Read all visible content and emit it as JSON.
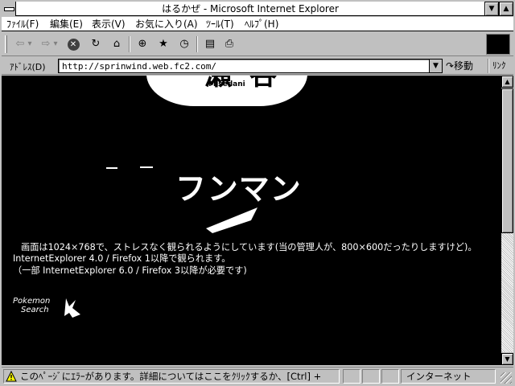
{
  "window": {
    "title": "はるかぜ - Microsoft Internet Explorer",
    "minimize_glyph": "▼",
    "maximize_glyph": "▲"
  },
  "menu": {
    "items": [
      {
        "label": "ﾌｧｲﾙ(F)"
      },
      {
        "label": "編集(E)"
      },
      {
        "label": "表示(V)"
      },
      {
        "label": "お気に入り(A)"
      },
      {
        "label": "ﾂｰﾙ(T)"
      },
      {
        "label": "ﾍﾙﾌﾟ(H)"
      }
    ]
  },
  "toolbar": {
    "back_glyph": "⇦",
    "forward_glyph": "⇨",
    "dropdown_glyph": "▾",
    "stop_glyph": "✕",
    "refresh_glyph": "↻",
    "home_glyph": "⌂",
    "search_glyph": "⊕",
    "favorites_glyph": "★",
    "history_glyph": "◷",
    "mail_glyph": "▤",
    "print_glyph": "⎙"
  },
  "address": {
    "label": "ｱﾄﾞﾚｽ(D)",
    "value": "http://sprinwind.web.fc2.com/",
    "dropdown_glyph": "▼",
    "go_label": "↷移動",
    "links_label": "ﾘﾝｸ"
  },
  "page": {
    "sign_kanji": "一瀬谷",
    "sign_romaji": "Misedani",
    "banner_text": "フンマン",
    "notice_lines": [
      "画面は1024×768で、ストレスなく観られるようにしています(当の管理人が、800×600だったりしますけど)。",
      "InternetExplorer 4.0 / Firefox 1以降で観られます。",
      "（一部 InternetExplorer 6.0 / Firefox 3以降が必要です)"
    ],
    "pokemon_line1": "Pokemon",
    "pokemon_line2": "Search"
  },
  "scrollbar": {
    "up_glyph": "▲",
    "down_glyph": "▼"
  },
  "status": {
    "message": "このﾍﾟｰｼﾞにｴﾗｰがあります。詳細についてはここをｸﾘｯｸするか、[Ctrl] +",
    "zone": "インターネット"
  }
}
